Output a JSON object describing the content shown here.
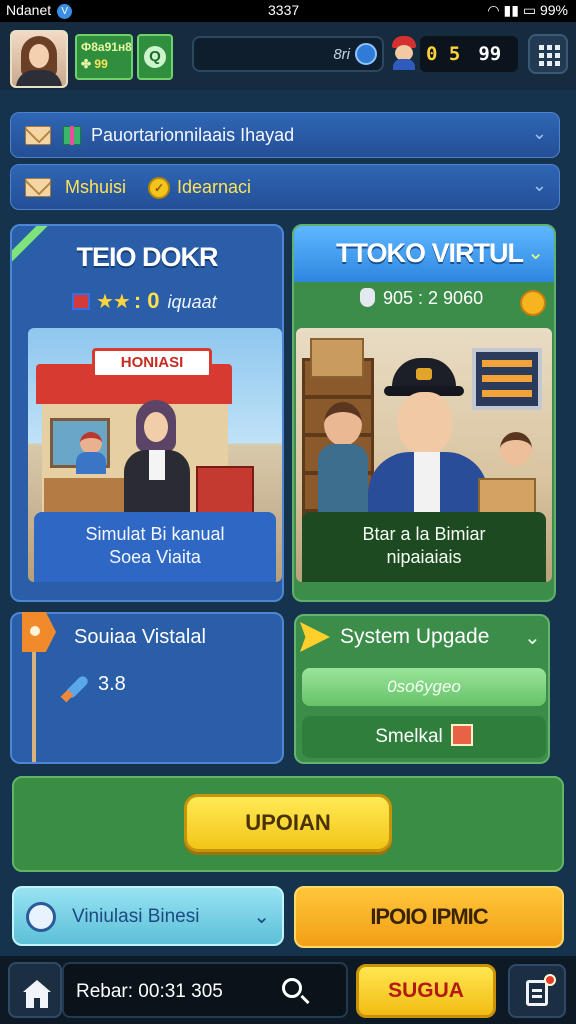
{
  "status_bar": {
    "carrier": "Ndanet",
    "badge": "V",
    "time": "3337",
    "battery": "99%"
  },
  "header": {
    "cash_line1": "Ф8а91н8",
    "cash_amount": "99",
    "help_icon": "Q",
    "search_text": "8ri",
    "score_a": "0 5",
    "score_b": "99"
  },
  "notices": [
    {
      "text": "Pauortarionnilaais Ihayad",
      "icon": "envelope-icon"
    },
    {
      "text": "Mshuisi",
      "text2": "Idearnaci",
      "icon": "envelope-icon"
    }
  ],
  "cards": {
    "left": {
      "title": "TEIO DOKR",
      "stars": "★★",
      "value": ": 0",
      "label": "iquaat",
      "shop_sign": "HONIASI",
      "caption_line1": "Simulat Bi kanual",
      "caption_line2": "Soea Viaita"
    },
    "right": {
      "title": "TTOKO VIRTUL",
      "value": "905 : 2 9060",
      "caption_line1": "Btar a la Bimiar",
      "caption_line2": "nipaiaiais"
    }
  },
  "panel_left": {
    "title": "Souiaa Vistalal",
    "value": "3.8"
  },
  "panel_right": {
    "title": "System Upgade",
    "field_text": "0so6ygeo",
    "button_label": "Smelkal"
  },
  "main_button": {
    "label": "UPOIAN"
  },
  "sim_row": {
    "label": "Viniulasi Binesi"
  },
  "orange_button": {
    "label": "IPOIO IPMIC"
  },
  "nav": {
    "text": "Rebar: 00:31  305",
    "action_label": "SUGUA"
  },
  "colors": {
    "background": "#16334d",
    "blue_card": "#2a5ea8",
    "green_card": "#3c8c4a",
    "yellow_button": "#f2c518",
    "orange_button": "#f29f16"
  }
}
